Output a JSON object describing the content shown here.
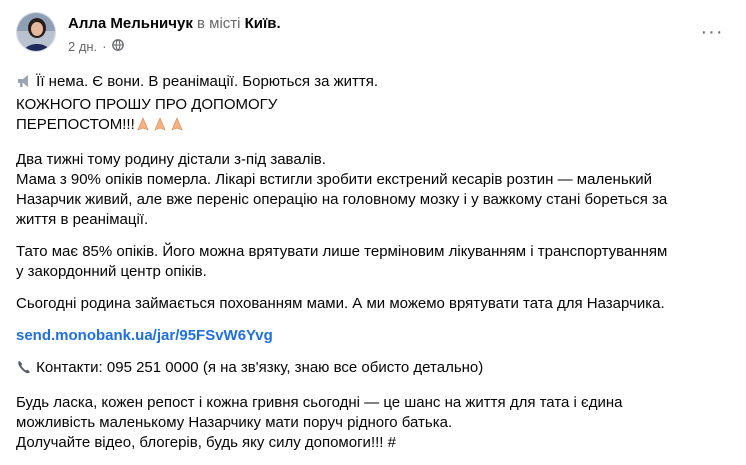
{
  "header": {
    "author": "Алла Мельничук",
    "location_prefix": "в місті",
    "city": "Київ.",
    "time": "2 дн.",
    "dot": "·",
    "audience_icon": "globe-icon",
    "more_icon": "more-horizontal-icon",
    "more_label": "···"
  },
  "post": {
    "p1": [
      "Її нема. Є вони. В реанімації. Борються за життя.",
      "КОЖНОГО ПРОШУ ПРО ДОПОМОГУ",
      "ПЕРЕПОСТОМ!!!"
    ],
    "p1_icons": [
      "megaphone-icon",
      "praying-hands-icon"
    ],
    "p2": [
      "Два тижні тому родину дістали з-під завалів.",
      "Мама з 90% опіків померла. Лікарі встигли зробити екстрений кесарів розтин — маленький",
      "Назарчик живий, але вже переніс операцію на головному мозку і у важкому стані бореться за",
      "життя в реанімації."
    ],
    "p3": [
      "Тато має 85% опіків. Його можна врятувати лише терміновим лікуванням і транспортуванням",
      "у закордонний центр опіків."
    ],
    "p4": "Сьогодні родина займається похованням мами. А ми можемо врятувати тата для Назарчика.",
    "link": "send.monobank.ua/jar/95FSvW6Yvg",
    "contacts": "Контакти: 095 251 0000 (я на зв'язку, знаю все обисто детально)",
    "contacts_icon": "telephone-icon",
    "p6": [
      "Будь ласка, кожен репост і кожна гривня сьогодні — це шанс на життя для тата і єдина",
      "можливість маленькому Назарчику мати поруч рідного батька.",
      "Долучайте відео, блогерів, будь яку силу допомоги!!! #"
    ]
  },
  "colors": {
    "link": "#216fdb",
    "muted": "#65676b",
    "text": "#050505"
  }
}
